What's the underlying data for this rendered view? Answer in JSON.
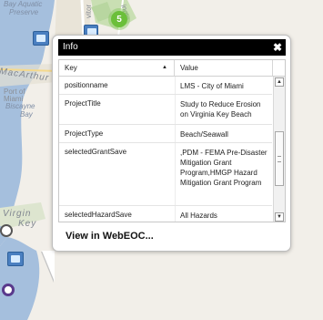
{
  "map": {
    "labels": {
      "bay_aquatic": "Bay Aquatic",
      "preserve": "Preserve",
      "street_1": "vitor",
      "street_2": "ingto",
      "macarthur": "MacArthur",
      "port_of": "Port of",
      "miami": "Miami",
      "biscayne": "Biscayne",
      "bay": "Bay",
      "virginia_key_1": "Virgin",
      "virginia_key_2": "Key"
    },
    "cluster_count": "5"
  },
  "popup": {
    "title": "Info",
    "close_glyph": "✖",
    "columns": {
      "key": "Key",
      "sort_glyph": "▲",
      "value": "Value"
    },
    "rows": [
      {
        "key": "positionname",
        "value": "LMS - City of Miami"
      },
      {
        "key": "ProjectTitle",
        "value": "Study to Reduce Erosion on Virginia Key Beach"
      },
      {
        "key": "ProjectType",
        "value": "Beach/Seawall"
      },
      {
        "key": "selectedGrantSave",
        "value": ",PDM - FEMA Pre-Disaster Mitigation Grant Program,HMGP Hazard Mitigation Grant Program"
      },
      {
        "key": "selectedHazardSave",
        "value": "All Hazards"
      }
    ],
    "scroll": {
      "up_glyph": "▲",
      "down_glyph": "▼"
    },
    "view_link": "View in WebEOC..."
  }
}
